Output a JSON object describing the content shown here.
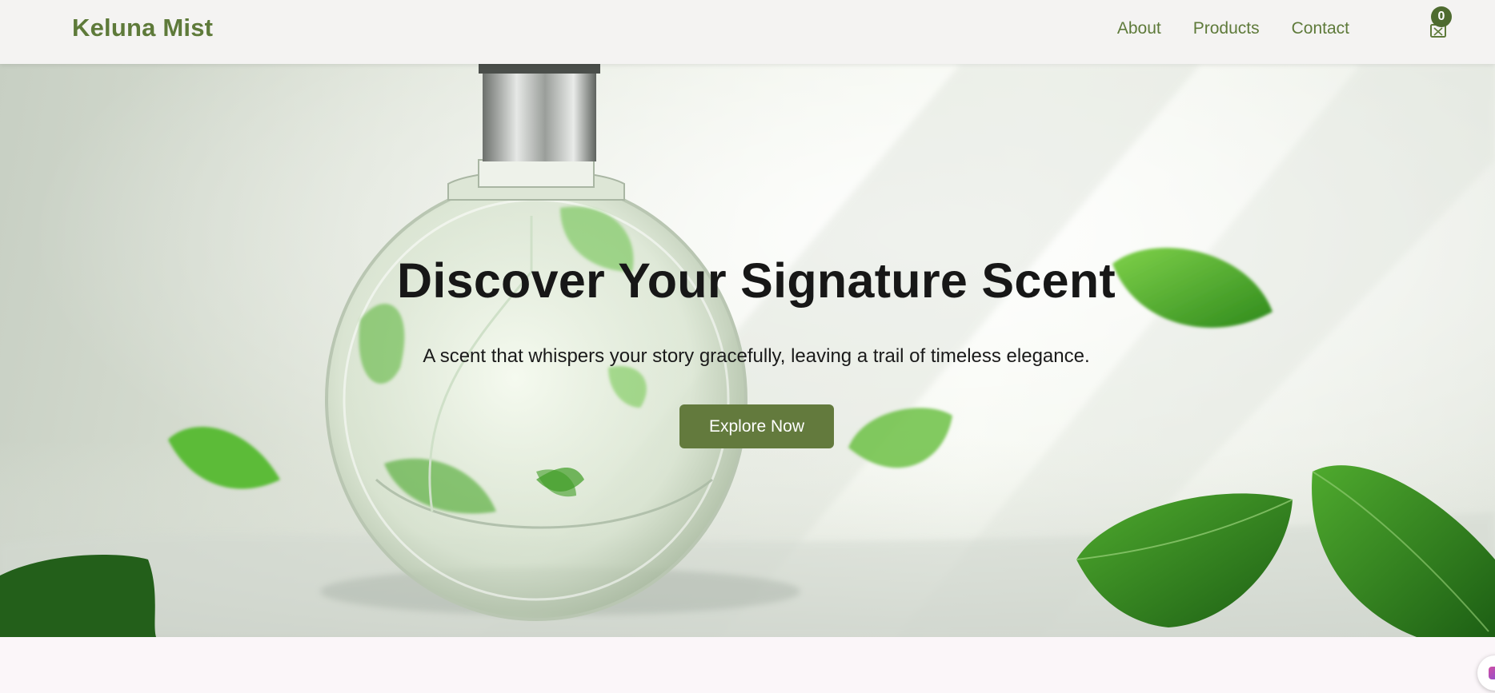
{
  "header": {
    "brand": "Keluna Mist",
    "nav": [
      {
        "label": "About"
      },
      {
        "label": "Products"
      },
      {
        "label": "Contact"
      }
    ],
    "cart": {
      "count": "0",
      "icon": "shopping-bag-icon"
    }
  },
  "hero": {
    "title": "Discover Your Signature Scent",
    "subtitle": "A scent that whispers your story gracefully, leaving a trail of timeless elegance.",
    "cta_label": "Explore Now",
    "background_image": "perfume-bottle-with-green-leaves"
  },
  "colors": {
    "brand": "#5e7a3a",
    "button": "#637a3d",
    "badge": "#4e6b30",
    "header_bg": "#f4f3f2",
    "page_bg": "#fbf6f9"
  },
  "floating_widget": {
    "icon": "chat-widget-icon"
  }
}
